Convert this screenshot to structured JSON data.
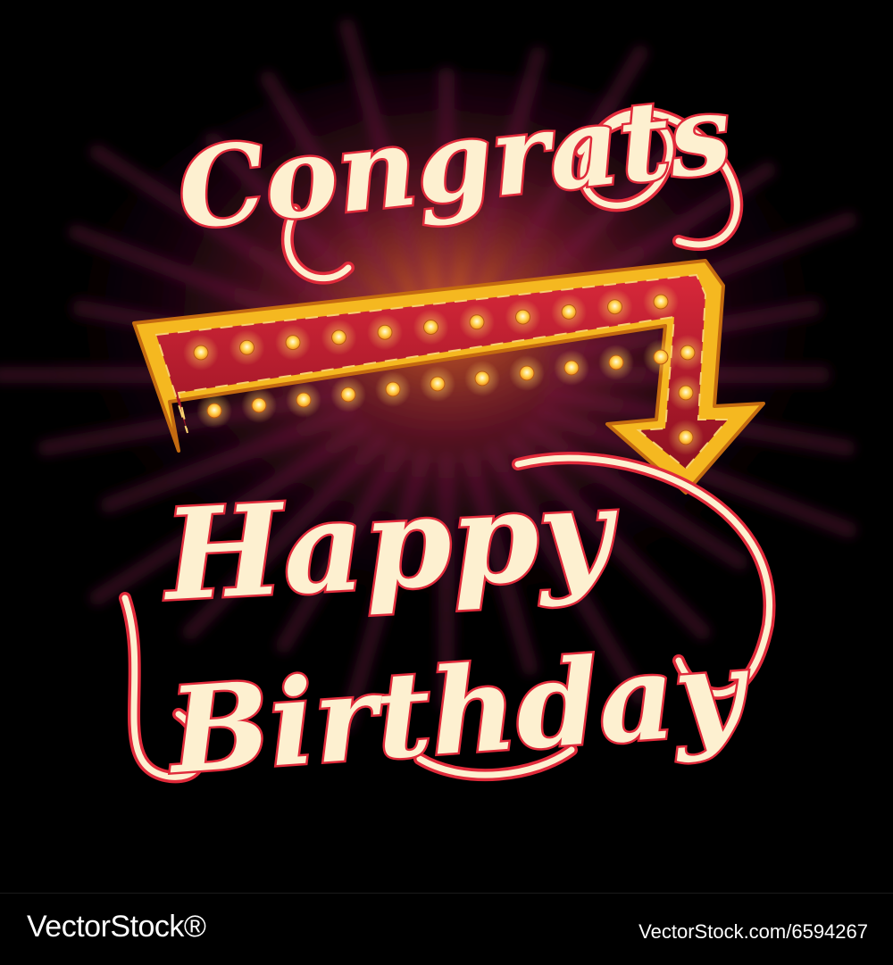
{
  "artwork": {
    "lettering": [
      "Congrats",
      "Happy",
      "Birthday"
    ],
    "colors": {
      "background": "#000000",
      "neon_fill": "#fdf0d0",
      "neon_outline": "#e02a3a",
      "arrow_body": "#b0182a",
      "arrow_frame": "#f5b820",
      "bulb": "#ffd24a"
    }
  },
  "watermark": {
    "logo_text": "VectorStock®",
    "url_text": "VectorStock.com/6594267"
  }
}
